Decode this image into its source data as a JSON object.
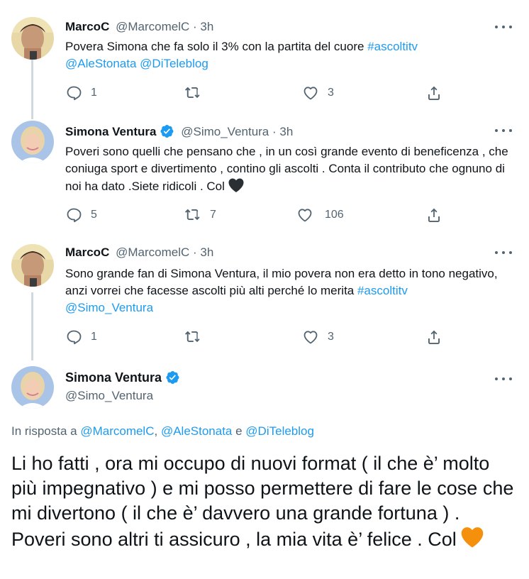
{
  "tweets": [
    {
      "name": "MarcoC",
      "handle": "@MarcomelC",
      "time": "3h",
      "text_plain": "Povera Simona che fa solo il 3% con la partita del cuore ",
      "text_link1": "#ascoltitv",
      "text_line2": "@AleStonata @DiTeleblog",
      "replies": "1",
      "retweets": "",
      "likes": "3"
    },
    {
      "name": "Simona Ventura",
      "handle": "@Simo_Ventura",
      "time": "3h",
      "text_plain": "Poveri sono quelli che pensano che , in un così grande evento di beneficenza , che coniuga sport e divertimento , contino gli ascolti . Conta il contributo  che ognuno di noi ha dato .Siete ridicoli . Col",
      "replies": "5",
      "retweets": "7",
      "likes": "106"
    },
    {
      "name": "MarcoC",
      "handle": "@MarcomelC",
      "time": "3h",
      "text_plain": "Sono grande fan di Simona Ventura, il mio povera non era detto in tono negativo, anzi vorrei che facesse ascolti più alti perché lo merita ",
      "text_link1": "#ascoltitv",
      "text_link2": "@Simo_Ventura",
      "replies": "1",
      "retweets": "",
      "likes": "3"
    }
  ],
  "main_tweet": {
    "name": "Simona Ventura",
    "handle": "@Simo_Ventura",
    "reply_prefix": "In risposta a ",
    "reply_user1": "@MarcomelC",
    "reply_sep1": ", ",
    "reply_user2": "@AleStonata",
    "reply_sep2": " e ",
    "reply_user3": "@DiTeleblog",
    "text": "Li ho fatti , ora mi occupo di nuovi format ( il che è’ molto più impegnativo ) e mi posso permettere di fare le cose che mi divertono ( il che è’ davvero una grande fortuna ) . Poveri sono altri ti assicuro , la mia vita è’ felice . Col"
  },
  "separator": " · ",
  "colors": {
    "link": "#1d9bf0",
    "verified": "#1d9bf0",
    "muted": "#536471",
    "thread_line": "#cfd9de",
    "heart_black": "#292f33",
    "heart_orange": "#f4900c"
  },
  "icons": [
    "more-icon",
    "reply-icon",
    "retweet-icon",
    "like-icon",
    "share-icon",
    "verified-icon",
    "heart-emoji-icon"
  ]
}
